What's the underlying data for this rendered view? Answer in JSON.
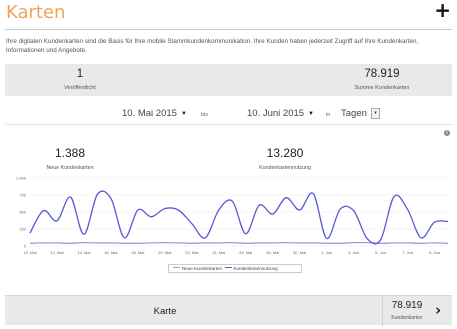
{
  "header": {
    "title": "Karten",
    "add_icon": "plus-icon",
    "description": "Ihre digitalen Kundenkarten sind die Basis für Ihre mobile Stammkundenkommunikation. Ihre Kunden haben jederzeit Zugriff auf Ihre Kundenkarten, Informationen und Angebote."
  },
  "stats": {
    "published_value": "1",
    "published_label": "Veröffentlicht",
    "total_value": "78.919",
    "total_label": "Summe Kundenkarten"
  },
  "date_filter": {
    "from": "10. Mai 2015",
    "between_label": "bis",
    "to": "10. Juni 2015",
    "unit_label": "in",
    "unit": "Tagen",
    "select_arrow": "▾",
    "caret": "▼"
  },
  "kpis": {
    "new_cards_value": "1.388",
    "new_cards_label": "Neue Kundenkarten",
    "usage_value": "13.280",
    "usage_label": "Kundenkartennutzung"
  },
  "info_icon": "i",
  "chart_data": {
    "type": "line",
    "y_ticks": [
      "1.000",
      "750",
      "500",
      "250",
      "0"
    ],
    "ylim": [
      0,
      1000
    ],
    "x_tick_labels": [
      "10. Mai",
      "12. Mai",
      "14. Mai",
      "16. Mai",
      "18. Mai",
      "20. Mai",
      "22. Mai",
      "24. Mai",
      "26. Mai",
      "28. Mai",
      "30. Mai",
      "1. Jun",
      "3. Jun",
      "5. Jun",
      "7. Jun",
      "9. Jun"
    ],
    "x": [
      "10. Mai",
      "11. Mai",
      "12. Mai",
      "13. Mai",
      "14. Mai",
      "15. Mai",
      "16. Mai",
      "17. Mai",
      "18. Mai",
      "19. Mai",
      "20. Mai",
      "21. Mai",
      "22. Mai",
      "23. Mai",
      "24. Mai",
      "25. Mai",
      "26. Mai",
      "27. Mai",
      "28. Mai",
      "29. Mai",
      "30. Mai",
      "31. Mai",
      "1. Jun",
      "2. Jun",
      "3. Jun",
      "4. Jun",
      "5. Jun",
      "6. Jun",
      "7. Jun",
      "8. Jun",
      "9. Jun",
      "10. Jun"
    ],
    "series": [
      {
        "name": "Neue Kundenkarten",
        "color": "#9b9be0",
        "values": [
          40,
          45,
          45,
          40,
          50,
          45,
          45,
          40,
          40,
          45,
          50,
          45,
          40,
          45,
          45,
          50,
          40,
          45,
          45,
          50,
          45,
          45,
          40,
          40,
          50,
          50,
          40,
          45,
          45,
          40,
          45,
          40
        ]
      },
      {
        "name": "Kundenkartennutzung",
        "color": "#5a5ad6",
        "values": [
          190,
          520,
          370,
          720,
          170,
          760,
          700,
          120,
          530,
          430,
          550,
          530,
          330,
          120,
          530,
          660,
          180,
          600,
          470,
          710,
          530,
          770,
          110,
          540,
          520,
          110,
          90,
          730,
          540,
          120,
          350,
          360
        ]
      }
    ],
    "legend_position": "bottom-center",
    "grid": true
  },
  "legend": {
    "new_label": "Neue Kundenkarten",
    "usage_label": "Kundenkartennutzung"
  },
  "footer": {
    "name": "Karte",
    "count": "78.919",
    "count_label": "Kundenkarten",
    "arrow": "›"
  }
}
